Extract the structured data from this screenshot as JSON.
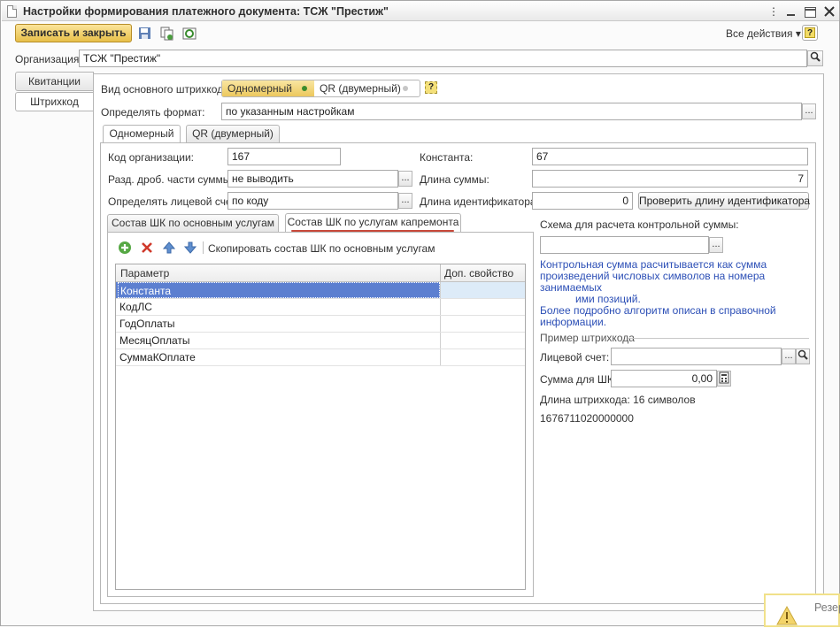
{
  "window": {
    "title": "Настройки формирования платежного документа: ТСЖ \"Престиж\""
  },
  "toolbar": {
    "save_close": "Записать и закрыть",
    "all_actions": "Все действия",
    "all_actions_arrow": "▾",
    "help": "?"
  },
  "org": {
    "label": "Организация:",
    "value": "ТСЖ \"Престиж\""
  },
  "side_tabs": [
    "Квитанции",
    "Штрихкод"
  ],
  "barcode_type": {
    "label": "Вид основного штрихкода:",
    "options": [
      "Одномерный",
      "QR (двумерный)"
    ],
    "selected": 0,
    "hint": "?"
  },
  "format": {
    "label": "Определять формат:",
    "value": "по указанным настройкам"
  },
  "inner_tabs": [
    "Одномерный",
    "QR (двумерный)"
  ],
  "fields": {
    "org_code_label": "Код организации:",
    "org_code": "167",
    "constant_label": "Константа:",
    "constant": "67",
    "fraction_label": "Разд. дроб. части суммы:",
    "fraction": "не выводить",
    "sum_len_label": "Длина суммы:",
    "sum_len": "7",
    "account_label": "Определять лицевой счет:",
    "account": "по коду",
    "id_len_label": "Длина идентификатора:",
    "id_len": "0",
    "check_btn": "Проверить длину идентификатора"
  },
  "composition_tabs": [
    "Состав ШК по основным услугам",
    "Состав ШК по услугам капремонта"
  ],
  "copy_btn": "Скопировать состав ШК по основным услугам",
  "table": {
    "columns": [
      "Параметр",
      "Доп. свойство"
    ],
    "rows": [
      "Константа",
      "КодЛС",
      "ГодОплаты",
      "МесяцОплаты",
      "СуммаКОплате"
    ],
    "selected_row": 0
  },
  "checksum": {
    "label": "Схема для расчета контрольной суммы:",
    "value": "",
    "info_lines": [
      "Контрольная сумма расчитывается как сумма",
      "произведений числовых символов на номера занимаемых",
      "ими позиций.",
      "Более подробно алгоритм описан в справочной",
      "информации."
    ]
  },
  "example": {
    "title": "Пример штрихкода",
    "account_label": "Лицевой счет:",
    "account_value": "",
    "sum_label": "Сумма для ШК:",
    "sum_value": "0,00",
    "length_text": "Длина штрихкода: 16 символов",
    "barcode": "1676711020000000"
  },
  "popup": {
    "text": "Резер"
  },
  "icons": [
    "document-icon",
    "minimize-icon",
    "maximize-icon",
    "close-icon",
    "save-icon",
    "copy-icon",
    "refresh-icon",
    "search-icon",
    "ellipsis-icon",
    "calculator-icon",
    "add-icon",
    "delete-icon",
    "move-up-icon",
    "move-down-icon",
    "warning-icon"
  ]
}
